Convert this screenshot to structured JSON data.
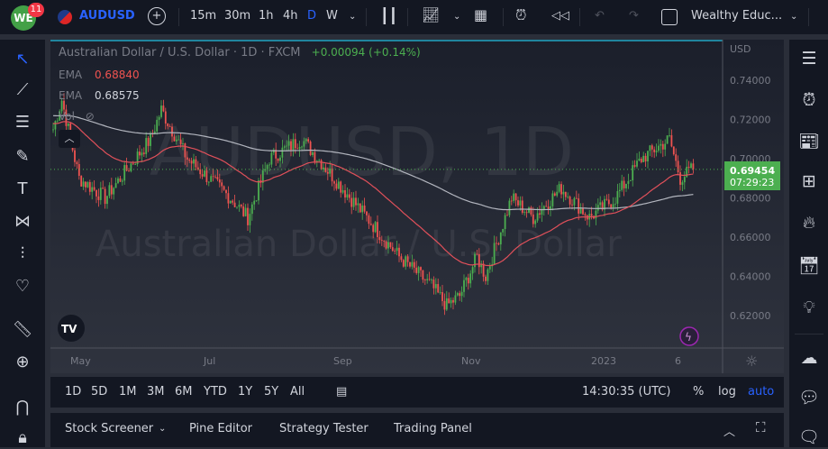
{
  "topbar": {
    "notif_count": "11",
    "symbol": "AUDUSD",
    "intervals": [
      "15m",
      "30m",
      "1h",
      "4h",
      "D",
      "W"
    ],
    "active_interval": "D",
    "layout_name": "Wealthy Educ..."
  },
  "legend": {
    "title": "Australian Dollar / U.S. Dollar · 1D · FXCM",
    "change": "+0.00094 (+0.14%)",
    "ema1_label": "EMA",
    "ema1_value": "0.68840",
    "ema2_label": "EMA",
    "ema2_value": "0.68575",
    "vol_label": "Vol"
  },
  "watermark": {
    "symbol": "AUDUSD, 1D",
    "name": "Australian Dollar / U.S. Dollar"
  },
  "price_axis": {
    "currency": "USD",
    "ticks": [
      "0.74000",
      "0.72000",
      "0.70000",
      "0.68000",
      "0.66000",
      "0.64000",
      "0.62000"
    ],
    "last_price": "0.69454",
    "countdown": "07:29:23"
  },
  "time_axis": {
    "labels": [
      "May",
      "Jul",
      "Sep",
      "Nov",
      "2023",
      "6"
    ]
  },
  "range_bar": {
    "ranges": [
      "1D",
      "5D",
      "1M",
      "3M",
      "6M",
      "YTD",
      "1Y",
      "5Y",
      "All"
    ],
    "clock": "14:30:35 (UTC)",
    "percent": "%",
    "log": "log",
    "auto": "auto"
  },
  "bottom_panel": {
    "tabs": [
      "Stock Screener",
      "Pine Editor",
      "Strategy Tester",
      "Trading Panel"
    ]
  },
  "colors": {
    "up": "#26a69a",
    "green": "#4caf50",
    "down": "#ef5350",
    "accent": "#2962ff",
    "ema50": "#e0505a",
    "ema200": "#b2b5be"
  },
  "chart_data": {
    "type": "candlestick",
    "ylim": [
      0.605,
      0.75
    ],
    "path": [
      [
        0,
        0.715
      ],
      [
        4,
        0.73
      ],
      [
        12,
        0.69
      ],
      [
        24,
        0.68
      ],
      [
        45,
        0.71
      ],
      [
        50,
        0.725
      ],
      [
        62,
        0.7
      ],
      [
        82,
        0.68
      ],
      [
        90,
        0.67
      ],
      [
        100,
        0.7
      ],
      [
        115,
        0.71
      ],
      [
        130,
        0.69
      ],
      [
        145,
        0.67
      ],
      [
        160,
        0.65
      ],
      [
        175,
        0.635
      ],
      [
        182,
        0.625
      ],
      [
        188,
        0.63
      ],
      [
        196,
        0.65
      ],
      [
        200,
        0.64
      ],
      [
        206,
        0.66
      ],
      [
        212,
        0.68
      ],
      [
        222,
        0.67
      ],
      [
        235,
        0.685
      ],
      [
        248,
        0.67
      ],
      [
        260,
        0.68
      ],
      [
        272,
        0.7
      ],
      [
        285,
        0.71
      ],
      [
        290,
        0.69
      ],
      [
        296,
        0.695
      ]
    ]
  }
}
